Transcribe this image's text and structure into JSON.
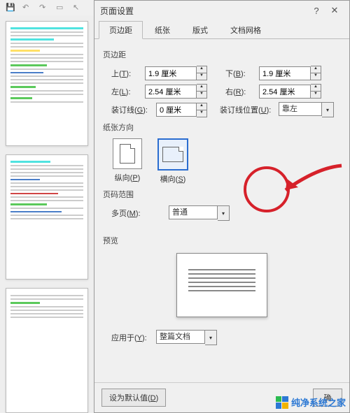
{
  "dialog": {
    "title": "页面设置",
    "tabs": [
      "页边距",
      "纸张",
      "版式",
      "文档网格"
    ],
    "active_tab": 0
  },
  "margins": {
    "section_label": "页边距",
    "top": {
      "label": "上",
      "key": "T",
      "value": "1.9 厘米"
    },
    "bottom": {
      "label": "下",
      "key": "B",
      "value": "1.9 厘米"
    },
    "left": {
      "label": "左",
      "key": "L",
      "value": "2.54 厘米"
    },
    "right": {
      "label": "右",
      "key": "R",
      "value": "2.54 厘米"
    },
    "gutter": {
      "label": "装订线",
      "key": "G",
      "value": "0 厘米"
    },
    "gutter_pos": {
      "label": "装订线位置",
      "key": "U",
      "value": "靠左"
    }
  },
  "orientation": {
    "section_label": "纸张方向",
    "portrait": {
      "label": "纵向",
      "key": "P"
    },
    "landscape": {
      "label": "横向",
      "key": "S"
    },
    "selected": "landscape"
  },
  "pages": {
    "section_label": "页码范围",
    "multi": {
      "label": "多页",
      "key": "M",
      "value": "普通"
    }
  },
  "preview": {
    "section_label": "预览"
  },
  "apply": {
    "label": "应用于",
    "key": "Y",
    "value": "整篇文档"
  },
  "footer": {
    "defaults_label": "设为默认值",
    "defaults_key": "D",
    "ok_label": "确"
  },
  "watermark": "纯净系统之家"
}
